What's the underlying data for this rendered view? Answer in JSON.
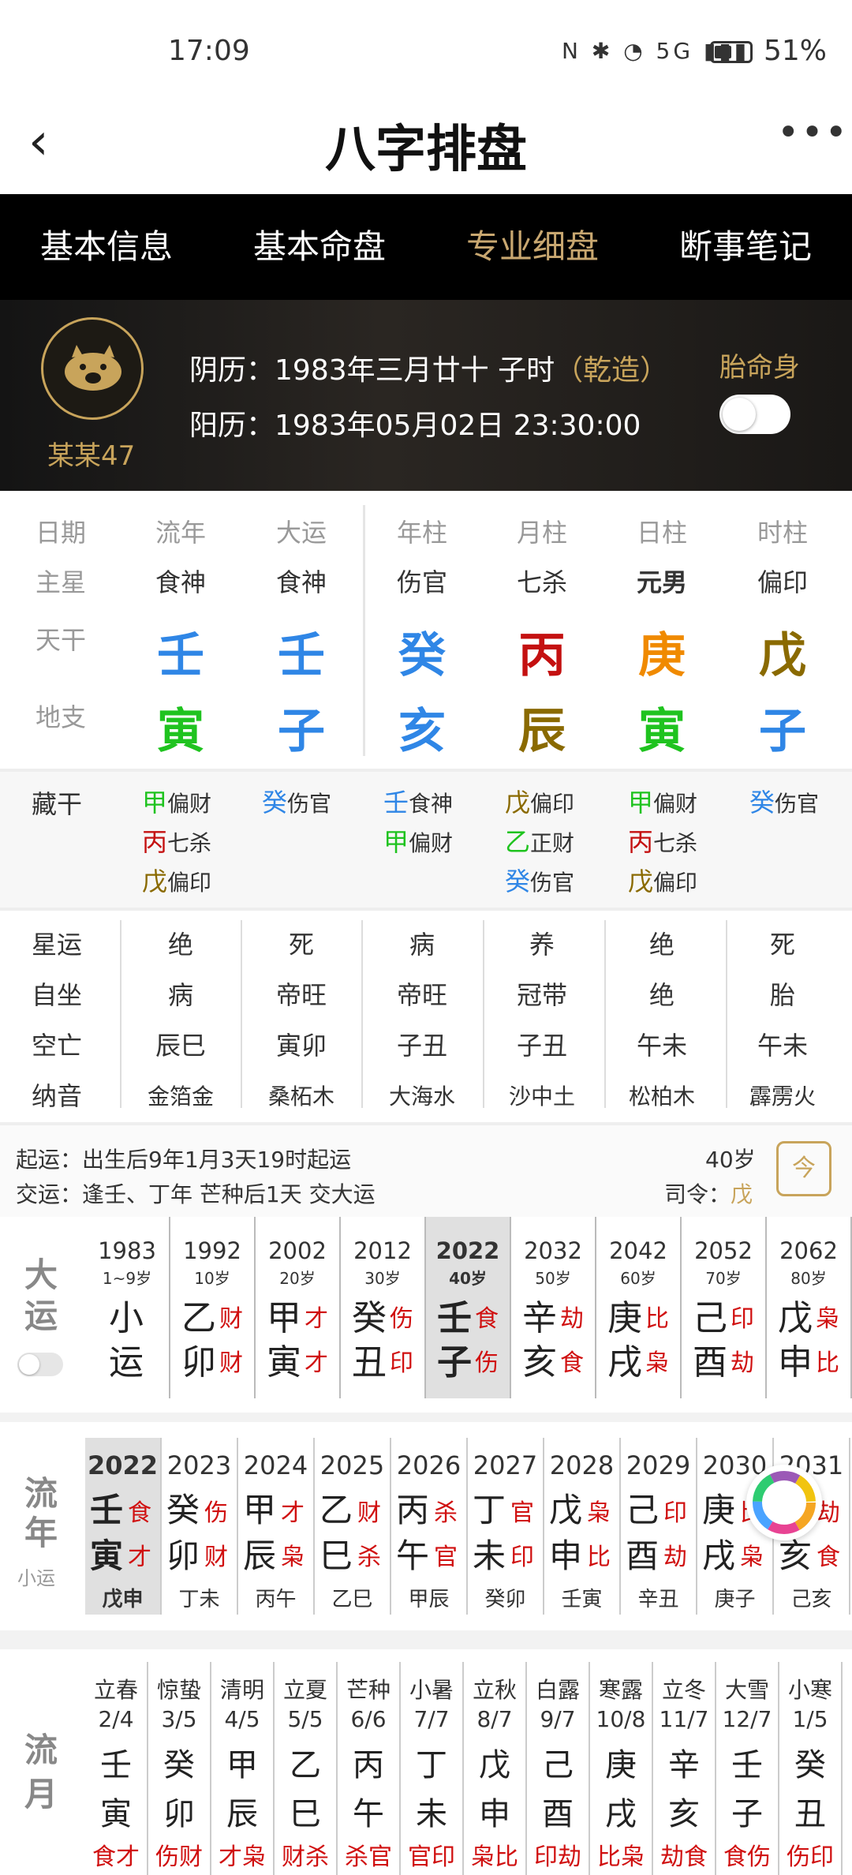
{
  "status": {
    "time": "17:09",
    "icons": "N ✱ ◔ 5G ▮▮▮",
    "battery": "51%",
    "battery_level": 0.51
  },
  "title": "八字排盘",
  "tabs": [
    "基本信息",
    "基本命盘",
    "专业细盘",
    "断事笔记"
  ],
  "active_tab": 2,
  "profile": {
    "name": "某某47",
    "lunar_label": "阴历：",
    "lunar": "1983年三月廿十 子时",
    "qianzao": "（乾造）",
    "solar_label": "阳历：",
    "solar": "1983年05月02日 23:30:00",
    "taimingshen": "胎命身"
  },
  "colors": {
    "wood": "#1fc31f",
    "water": "#2f86e6",
    "fire": "#c41010",
    "metal": "#f08a00",
    "earth": "#8a6a00",
    "gold": "#c8a45b",
    "red": "#d01010"
  },
  "chart": {
    "headers": [
      "日期",
      "流年",
      "大运",
      "年柱",
      "月柱",
      "日柱",
      "时柱"
    ],
    "zhuxing": [
      "主星",
      "食神",
      "食神",
      "伤官",
      "七杀",
      "元男",
      "偏印"
    ],
    "tiangan_label": "天干",
    "tiangan": [
      "壬",
      "壬",
      "癸",
      "丙",
      "庚",
      "戊"
    ],
    "tiangan_colors": [
      "#2f86e6",
      "#2f86e6",
      "#2f86e6",
      "#c41010",
      "#f08a00",
      "#8a6a00"
    ],
    "dizhi_label": "地支",
    "dizhi": [
      "寅",
      "子",
      "亥",
      "辰",
      "寅",
      "子"
    ],
    "dizhi_colors": [
      "#1fc31f",
      "#2f86e6",
      "#2f86e6",
      "#8a6a00",
      "#1fc31f",
      "#2f86e6"
    ]
  },
  "canggan": {
    "label": "藏干",
    "cols": [
      [
        {
          "g": "甲",
          "c": "#1fc31f",
          "s": "偏财"
        },
        {
          "g": "丙",
          "c": "#c41010",
          "s": "七杀"
        },
        {
          "g": "戊",
          "c": "#8a6a00",
          "s": "偏印"
        }
      ],
      [
        {
          "g": "癸",
          "c": "#2f86e6",
          "s": "伤官"
        }
      ],
      [
        {
          "g": "壬",
          "c": "#2f86e6",
          "s": "食神"
        },
        {
          "g": "甲",
          "c": "#1fc31f",
          "s": "偏财"
        }
      ],
      [
        {
          "g": "戊",
          "c": "#8a6a00",
          "s": "偏印"
        },
        {
          "g": "乙",
          "c": "#1fc31f",
          "s": "正财"
        },
        {
          "g": "癸",
          "c": "#2f86e6",
          "s": "伤官"
        }
      ],
      [
        {
          "g": "甲",
          "c": "#1fc31f",
          "s": "偏财"
        },
        {
          "g": "丙",
          "c": "#c41010",
          "s": "七杀"
        },
        {
          "g": "戊",
          "c": "#8a6a00",
          "s": "偏印"
        }
      ],
      [
        {
          "g": "癸",
          "c": "#2f86e6",
          "s": "伤官"
        }
      ]
    ]
  },
  "xingyun": {
    "labels": [
      "星运",
      "自坐",
      "空亡",
      "纳音"
    ],
    "rows": [
      [
        "绝",
        "死",
        "病",
        "养",
        "绝",
        "死"
      ],
      [
        "病",
        "帝旺",
        "帝旺",
        "冠带",
        "绝",
        "胎"
      ],
      [
        "辰巳",
        "寅卯",
        "子丑",
        "子丑",
        "午未",
        "午未"
      ],
      [
        "金箔金",
        "桑柘木",
        "大海水",
        "沙中土",
        "松柏木",
        "霹雳火"
      ]
    ]
  },
  "qiyun": {
    "label1": "起运：",
    "text1": "出生后9年1月3天19时起运",
    "label2": "交运：",
    "text2": "逢壬、丁年 芒种后1天 交大运",
    "age": "40岁",
    "siling_label": "司令：",
    "siling": "戊",
    "today_btn": "今"
  },
  "dayun": {
    "label": "大运",
    "cols": [
      {
        "year": "1983",
        "age": "1~9岁",
        "g": "小",
        "z": "运",
        "t1": "",
        "t2": ""
      },
      {
        "year": "1992",
        "age": "10岁",
        "g": "乙",
        "z": "卯",
        "t1": "财",
        "t2": "财"
      },
      {
        "year": "2002",
        "age": "20岁",
        "g": "甲",
        "z": "寅",
        "t1": "才",
        "t2": "才"
      },
      {
        "year": "2012",
        "age": "30岁",
        "g": "癸",
        "z": "丑",
        "t1": "伤",
        "t2": "印"
      },
      {
        "year": "2022",
        "age": "40岁",
        "g": "壬",
        "z": "子",
        "t1": "食",
        "t2": "伤"
      },
      {
        "year": "2032",
        "age": "50岁",
        "g": "辛",
        "z": "亥",
        "t1": "劫",
        "t2": "食"
      },
      {
        "year": "2042",
        "age": "60岁",
        "g": "庚",
        "z": "戌",
        "t1": "比",
        "t2": "枭"
      },
      {
        "year": "2052",
        "age": "70岁",
        "g": "己",
        "z": "酉",
        "t1": "印",
        "t2": "劫"
      },
      {
        "year": "2062",
        "age": "80岁",
        "g": "戊",
        "z": "申",
        "t1": "枭",
        "t2": "比"
      }
    ],
    "selected": 4
  },
  "liunian": {
    "label": "流年",
    "sub": "小运",
    "cols": [
      {
        "year": "2022",
        "g": "壬",
        "z": "寅",
        "t1": "食",
        "t2": "才",
        "gz": "戊申"
      },
      {
        "year": "2023",
        "g": "癸",
        "z": "卯",
        "t1": "伤",
        "t2": "财",
        "gz": "丁未"
      },
      {
        "year": "2024",
        "g": "甲",
        "z": "辰",
        "t1": "才",
        "t2": "枭",
        "gz": "丙午"
      },
      {
        "year": "2025",
        "g": "乙",
        "z": "巳",
        "t1": "财",
        "t2": "杀",
        "gz": "乙巳"
      },
      {
        "year": "2026",
        "g": "丙",
        "z": "午",
        "t1": "杀",
        "t2": "官",
        "gz": "甲辰"
      },
      {
        "year": "2027",
        "g": "丁",
        "z": "未",
        "t1": "官",
        "t2": "印",
        "gz": "癸卯"
      },
      {
        "year": "2028",
        "g": "戊",
        "z": "申",
        "t1": "枭",
        "t2": "比",
        "gz": "壬寅"
      },
      {
        "year": "2029",
        "g": "己",
        "z": "酉",
        "t1": "印",
        "t2": "劫",
        "gz": "辛丑"
      },
      {
        "year": "2030",
        "g": "庚",
        "z": "戌",
        "t1": "比",
        "t2": "枭",
        "gz": "庚子"
      },
      {
        "year": "2031",
        "g": "辛",
        "z": "亥",
        "t1": "劫",
        "t2": "食",
        "gz": "己亥"
      }
    ],
    "selected": 0
  },
  "liuyue": {
    "label": "流月",
    "cols": [
      {
        "term": "立春",
        "date": "2/4",
        "g": "壬",
        "z": "寅",
        "t": "食才"
      },
      {
        "term": "惊蛰",
        "date": "3/5",
        "g": "癸",
        "z": "卯",
        "t": "伤财"
      },
      {
        "term": "清明",
        "date": "4/5",
        "g": "甲",
        "z": "辰",
        "t": "才枭"
      },
      {
        "term": "立夏",
        "date": "5/5",
        "g": "乙",
        "z": "巳",
        "t": "财杀"
      },
      {
        "term": "芒种",
        "date": "6/6",
        "g": "丙",
        "z": "午",
        "t": "杀官"
      },
      {
        "term": "小暑",
        "date": "7/7",
        "g": "丁",
        "z": "未",
        "t": "官印"
      },
      {
        "term": "立秋",
        "date": "8/7",
        "g": "戊",
        "z": "申",
        "t": "枭比"
      },
      {
        "term": "白露",
        "date": "9/7",
        "g": "己",
        "z": "酉",
        "t": "印劫"
      },
      {
        "term": "寒露",
        "date": "10/8",
        "g": "庚",
        "z": "戌",
        "t": "比枭"
      },
      {
        "term": "立冬",
        "date": "11/7",
        "g": "辛",
        "z": "亥",
        "t": "劫食"
      },
      {
        "term": "大雪",
        "date": "12/7",
        "g": "壬",
        "z": "子",
        "t": "食伤"
      },
      {
        "term": "小寒",
        "date": "1/5",
        "g": "癸",
        "z": "丑",
        "t": "伤印"
      }
    ]
  }
}
